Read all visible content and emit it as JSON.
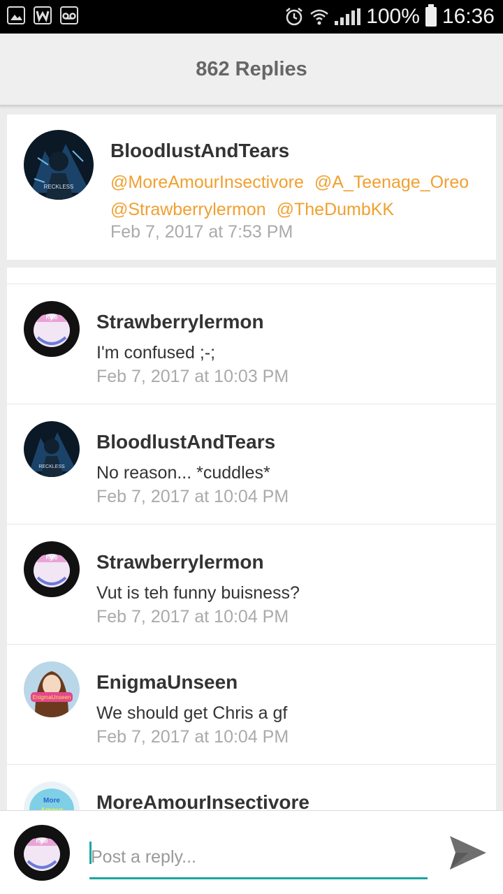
{
  "status_bar": {
    "battery": "100%",
    "time": "16:36",
    "icons": [
      "image-icon",
      "w-app-icon",
      "voicemail-icon",
      "alarm-icon",
      "wifi-icon",
      "signal-icon",
      "battery-icon"
    ]
  },
  "header": {
    "title": "862 Replies"
  },
  "original_post": {
    "author": "BloodlustAndTears",
    "mentions": [
      "@MoreAmourInsectivore",
      "@A_Teenage_Oreo",
      "@Strawberrylermon",
      "@TheDumbKK"
    ],
    "time": "Feb 7, 2017 at 7:53 PM",
    "avatar_label": "RECKLESS"
  },
  "replies": [
    {
      "author": "Strawberrylermon",
      "text": "I'm confused ;-;",
      "time": "Feb 7, 2017 at 10:03 PM",
      "avatar_label": "Kyle"
    },
    {
      "author": "BloodlustAndTears",
      "text": "No reason... *cuddles*",
      "time": "Feb 7, 2017 at 10:04 PM",
      "avatar_label": "RECKLESS"
    },
    {
      "author": "Strawberrylermon",
      "text": "Vut is teh funny buisness?",
      "time": "Feb 7, 2017 at 10:04 PM",
      "avatar_label": "Kyle"
    },
    {
      "author": "EnigmaUnseen",
      "text": "We should get Chris a gf",
      "time": "Feb 7, 2017 at 10:04 PM",
      "avatar_label": "EnigmaUnseen"
    },
    {
      "author": "MoreAmourInsectivore",
      "text": "",
      "time": "",
      "avatar_label": "More Amour"
    }
  ],
  "reply_bar": {
    "placeholder": "Post a reply...",
    "avatar_label": "Kyle"
  },
  "colors": {
    "mention": "#f0a030",
    "accent": "#17a7a0",
    "timestamp": "#aaaaaa",
    "header_bg": "#efefef"
  }
}
